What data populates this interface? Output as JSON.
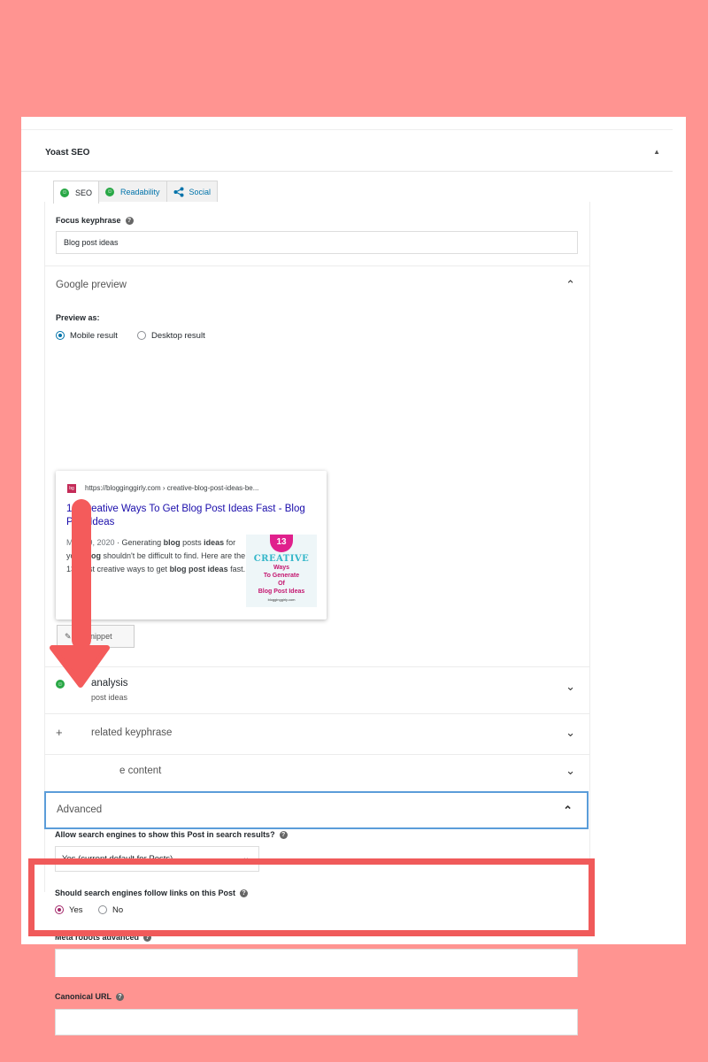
{
  "panel": {
    "title": "Yoast SEO"
  },
  "tabs": [
    {
      "label": "SEO",
      "icon": "smiley-icon"
    },
    {
      "label": "Readability",
      "icon": "smiley-icon"
    },
    {
      "label": "Social",
      "icon": "share-icon"
    }
  ],
  "focus": {
    "label": "Focus keyphrase",
    "value": "Blog post ideas"
  },
  "google_preview": {
    "title": "Google preview",
    "preview_as": "Preview as:",
    "mobile": "Mobile result",
    "desktop": "Desktop result",
    "selected": "Mobile result",
    "favicon": "bg",
    "url": "https://blogginggirly.com › creative-blog-post-ideas-be...",
    "serp_title": "13 Creative Ways To Get Blog Post Ideas Fast - Blog Post Ideas",
    "date": "May 29, 2020",
    "thumb": {
      "num": "13",
      "line1": "CREATIVE",
      "line2": "Ways",
      "line3": "To Generate",
      "line4": "Of",
      "line5": "Blog Post Ideas",
      "line6": "blogginggirly.com"
    },
    "edit_snippet": "t snippet"
  },
  "sections": {
    "analysis_title": "analysis",
    "analysis_sub": "post ideas",
    "related": "related keyphrase",
    "cornerstone": "e content"
  },
  "advanced": {
    "title": "Advanced",
    "allow_label": "Allow search engines to show this Post in search results?",
    "allow_value": "Yes (current default for Posts)",
    "follow_label": "Should search engines follow links on this Post",
    "yes": "Yes",
    "no": "No",
    "meta_label": "Meta robots advanced",
    "canonical_label": "Canonical URL",
    "canonical_value": ""
  },
  "colors": {
    "background": "#ff9491",
    "highlight": "#f05a5a",
    "link": "#1a0dab"
  }
}
